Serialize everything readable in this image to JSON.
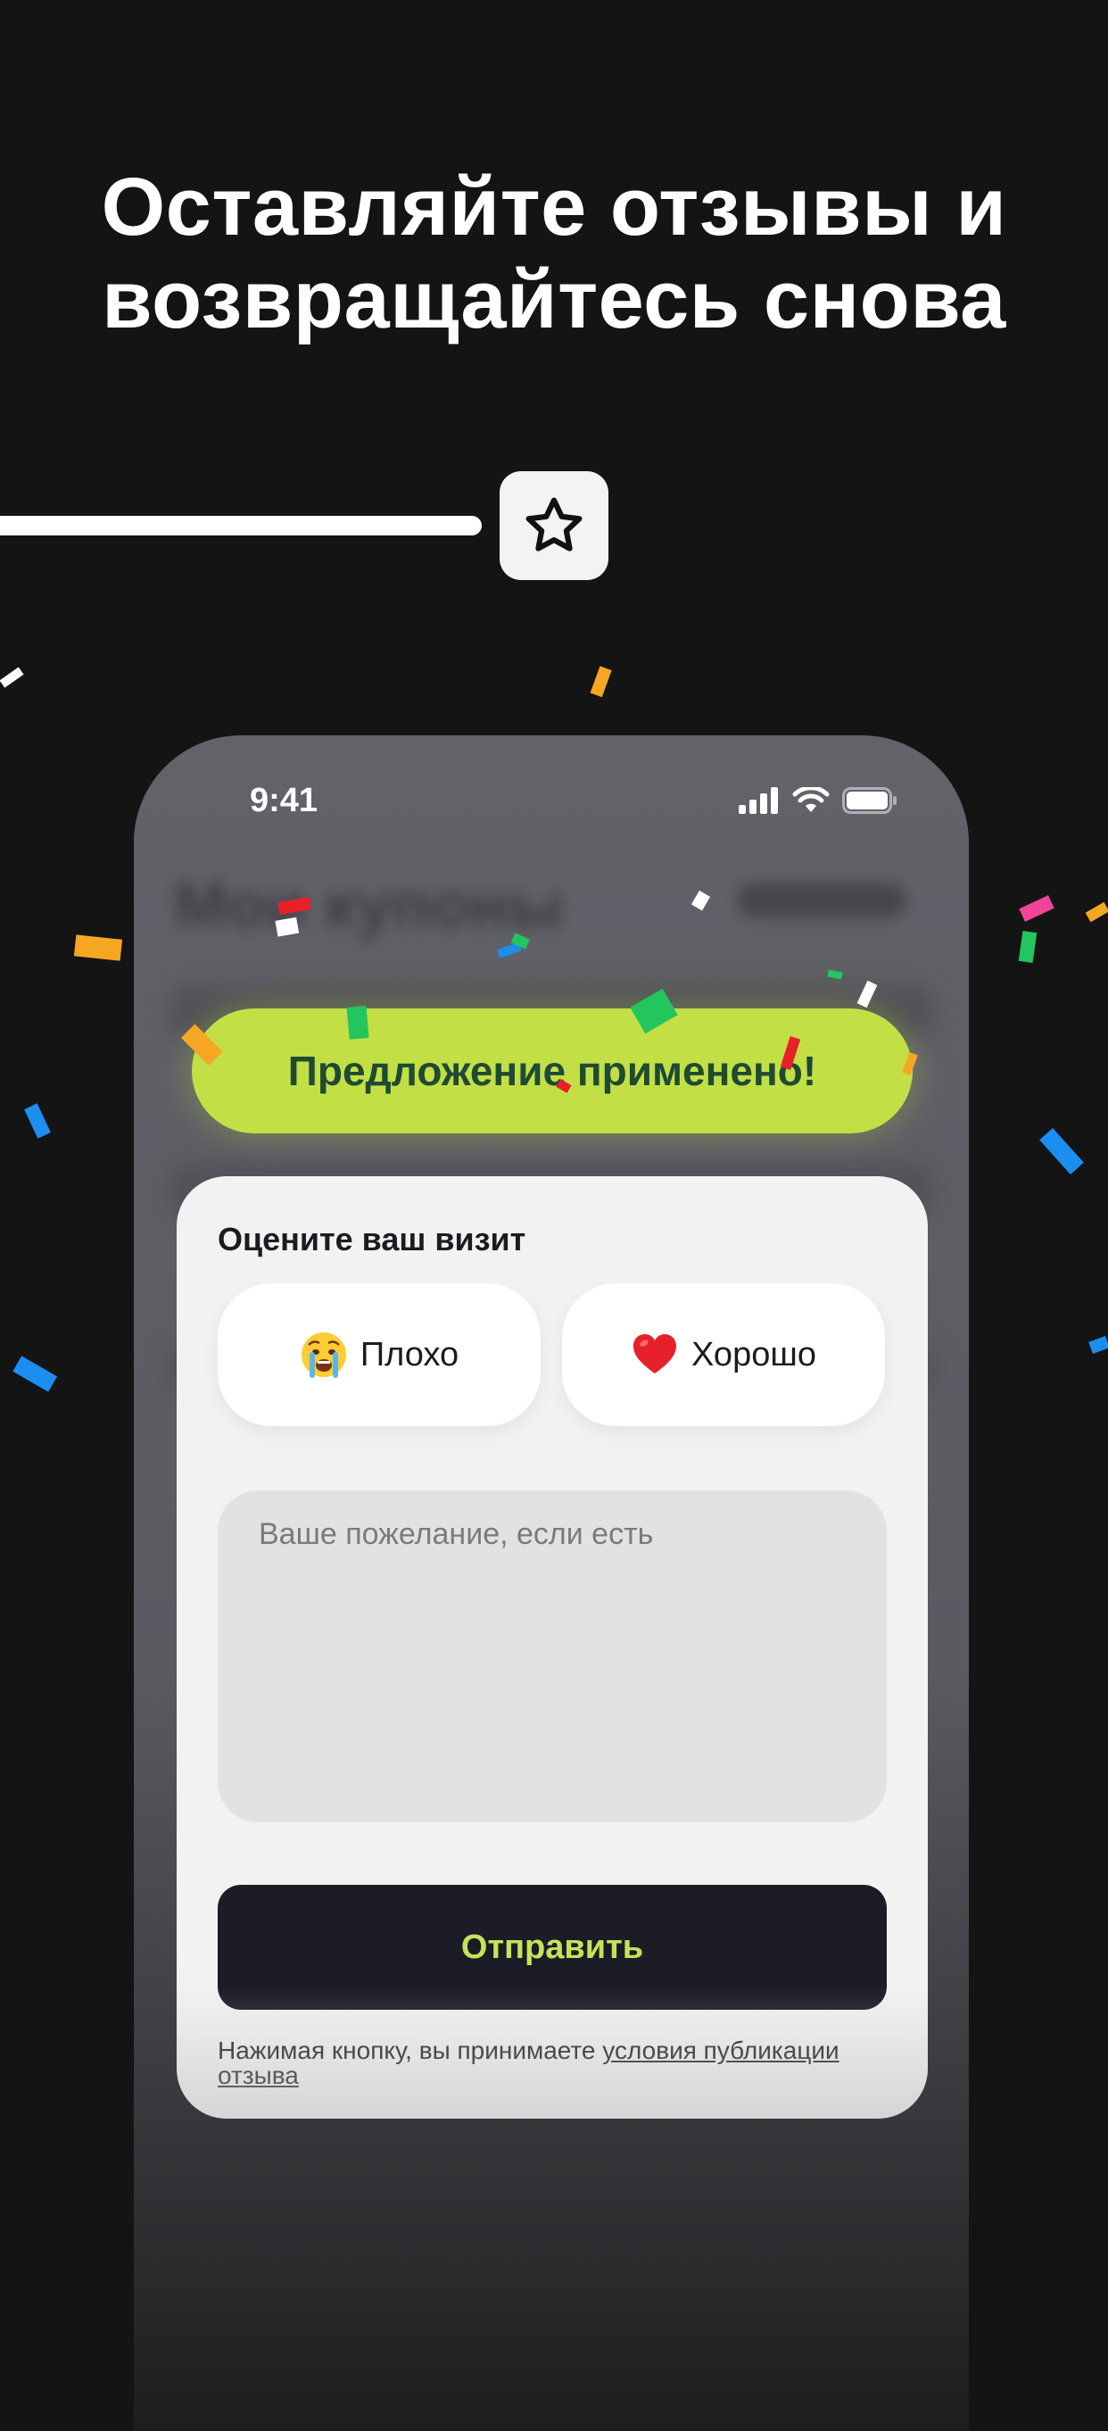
{
  "headline": {
    "line1": "Оставляйте отзывы и",
    "line2": "возвращайтесь снова"
  },
  "progress": {
    "icon": "star-outline-icon"
  },
  "phone": {
    "status": {
      "time": "9:41",
      "icons": [
        "cellular-signal-icon",
        "wifi-icon",
        "battery-icon"
      ]
    },
    "background_screen": {
      "title": "Мои купоны"
    }
  },
  "banner": {
    "text": "Предложение применено!",
    "color": "#c2e046"
  },
  "feedback": {
    "title": "Оцените ваш визит",
    "options": [
      {
        "label": "Плохо",
        "icon": "crying-face-emoji"
      },
      {
        "label": "Хорошо",
        "icon": "red-heart-emoji"
      }
    ],
    "wish_placeholder": "Ваше пожелание, если есть",
    "wish_value": "",
    "submit_label": "Отправить",
    "terms_prefix": "Нажимая кнопку, вы принимаете ",
    "terms_link": "условия публикации отзыва"
  },
  "colors": {
    "background": "#141415",
    "accent": "#c2e046",
    "button_dark": "#1c1c26",
    "card": "#f1f2f1"
  }
}
